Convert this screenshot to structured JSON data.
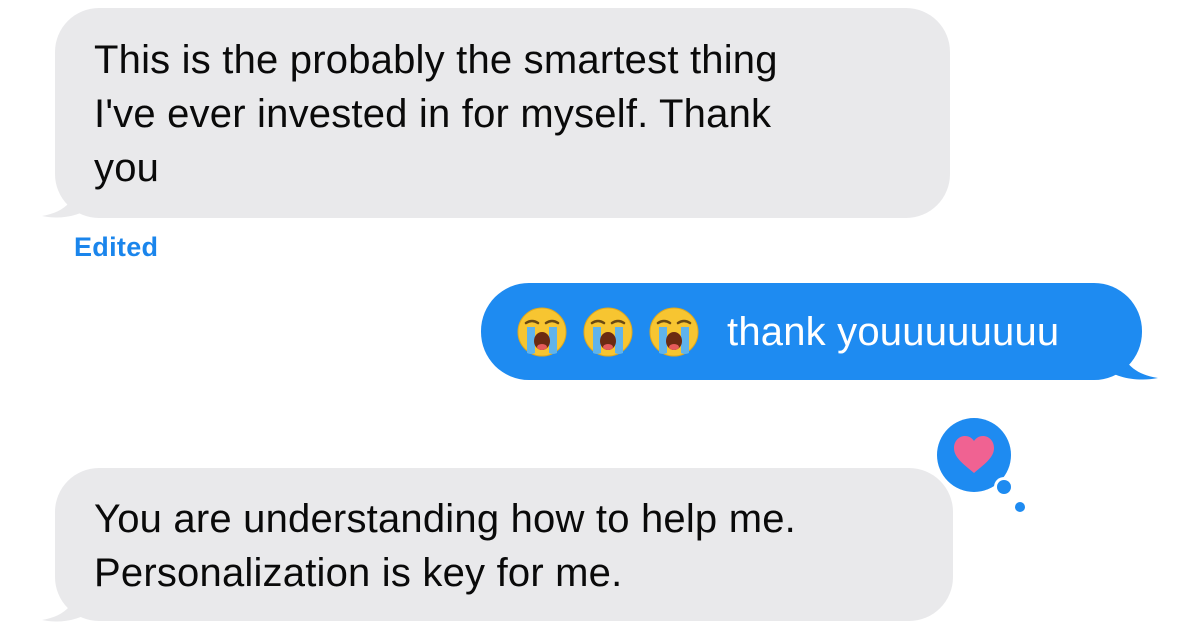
{
  "conversation": {
    "messages": [
      {
        "direction": "received",
        "text": "This is the probably the smartest thing\nI've ever invested in for myself. Thank\nyou",
        "status_label": "Edited"
      },
      {
        "direction": "sent",
        "emojis": [
          "loudly-crying-face",
          "loudly-crying-face",
          "loudly-crying-face"
        ],
        "text": "thank youuuuuuuu"
      },
      {
        "direction": "received",
        "text": "You are understanding how to help me.\nPersonalization is key for me.",
        "reaction": "heart-icon"
      }
    ]
  },
  "colors": {
    "received_bubble": "#e9e9eb",
    "sent_bubble": "#1e8bf1",
    "edited_label": "#1a85ec",
    "reaction_bubble": "#1e8bf1",
    "heart": "#f06292"
  }
}
